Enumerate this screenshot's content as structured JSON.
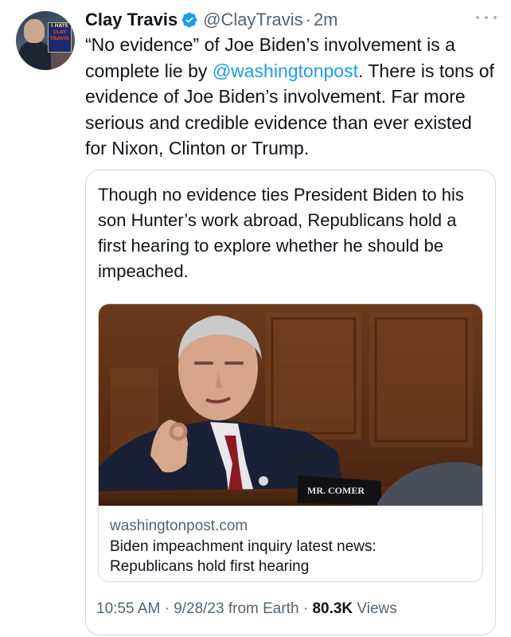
{
  "author": {
    "name": "Clay Travis",
    "handle": "@ClayTravis",
    "separator": "·",
    "time": "2m",
    "avatar_sign": [
      "I HATE",
      "CLAY",
      "TRAVIS"
    ]
  },
  "tweet": {
    "text_before": "“No evidence” of Joe Biden’s involvement is a complete lie by ",
    "mention": "@washingtonpost",
    "text_after": ". There is tons of evidence of Joe Biden’s involvement. Far more serious and credible evidence than ever existed for Nixon, Clinton or Trump."
  },
  "quote_card": {
    "text": "Though no evidence ties President Biden to his son Hunter’s work abroad, Republicans hold a first hearing to explore whether he should be impeached.",
    "nameplate": "MR. COMER",
    "link_domain": "washingtonpost.com",
    "link_headline_line1": "Biden impeachment inquiry latest news:",
    "link_headline_line2": "Republicans hold first hearing"
  },
  "footer": {
    "time": "10:55 AM",
    "date_location": "9/28/23 from Earth",
    "sep": "·",
    "views_count": "80.3K",
    "views_label": "Views"
  },
  "colors": {
    "accent": "#1d9bf0",
    "text": "#0f1419",
    "secondary": "#536471",
    "border": "#cfd9de"
  },
  "icons": [
    "verified-badge-icon",
    "more-options-icon"
  ]
}
